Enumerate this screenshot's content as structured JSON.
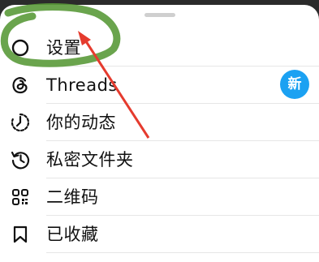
{
  "menu": {
    "items": [
      {
        "label": "设置",
        "icon": "gear-icon"
      },
      {
        "label": "Threads",
        "icon": "threads-icon",
        "badge": "新"
      },
      {
        "label": "你的动态",
        "icon": "activity-icon"
      },
      {
        "label": "私密文件夹",
        "icon": "history-icon"
      },
      {
        "label": "二维码",
        "icon": "qr-code-icon"
      },
      {
        "label": "已收藏",
        "icon": "bookmark-icon"
      }
    ]
  },
  "colors": {
    "badge": "#1ba1f2",
    "annotation_scribble": "#5a9a3a",
    "annotation_arrow": "#e53b2e"
  }
}
